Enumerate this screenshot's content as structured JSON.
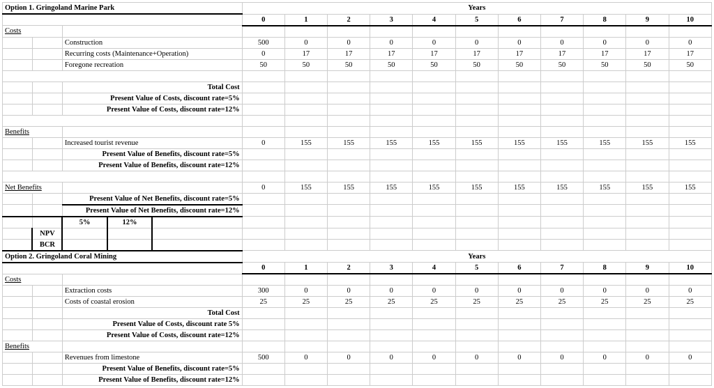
{
  "option1": {
    "title": "Option 1. Gringoland Marine Park",
    "years_label": "Years",
    "costs_label": "Costs",
    "benefits_label": "Benefits",
    "net_benefits_label": "Net Benefits",
    "rows": {
      "construction": {
        "label": "Construction",
        "vals": [
          "500",
          "0",
          "0",
          "0",
          "0",
          "0",
          "0",
          "0",
          "0",
          "0",
          "0"
        ]
      },
      "recurring": {
        "label": "Recurring costs (Maintenance+Operation)",
        "vals": [
          "0",
          "17",
          "17",
          "17",
          "17",
          "17",
          "17",
          "17",
          "17",
          "17",
          "17"
        ]
      },
      "foregone": {
        "label": "Foregone recreation",
        "vals": [
          "50",
          "50",
          "50",
          "50",
          "50",
          "50",
          "50",
          "50",
          "50",
          "50",
          "50"
        ]
      },
      "tourist": {
        "label": "Increased tourist revenue",
        "vals": [
          "0",
          "155",
          "155",
          "155",
          "155",
          "155",
          "155",
          "155",
          "155",
          "155",
          "155"
        ]
      },
      "netbenefits": {
        "vals": [
          "0",
          "155",
          "155",
          "155",
          "155",
          "155",
          "155",
          "155",
          "155",
          "155",
          "155"
        ]
      }
    },
    "total_cost": "Total Cost",
    "pv_costs_5": "Present Value of Costs, discount rate=5%",
    "pv_costs_12": "Present Value of Costs, discount rate=12%",
    "pv_ben_5": "Present Value of Benefits, discount rate=5%",
    "pv_ben_12": "Present Value of Benefits, discount rate=12%",
    "pv_net_5": "Present Value of Net Benefits, discount rate=5%",
    "pv_net_12": "Present Value of Net Benefits, discount rate=12%",
    "rate_5": "5%",
    "rate_12": "12%",
    "npv": "NPV",
    "bcr": "BCR"
  },
  "option2": {
    "title": "Option 2. Gringoland Coral Mining",
    "years_label": "Years",
    "costs_label": "Costs",
    "benefits_label": "Benefits",
    "rows": {
      "extraction": {
        "label": "Extraction costs",
        "vals": [
          "300",
          "0",
          "0",
          "0",
          "0",
          "0",
          "0",
          "0",
          "0",
          "0",
          "0"
        ]
      },
      "erosion": {
        "label": "Costs of coastal erosion",
        "vals": [
          "25",
          "25",
          "25",
          "25",
          "25",
          "25",
          "25",
          "25",
          "25",
          "25",
          "25"
        ]
      },
      "limestone": {
        "label": "Revenues from limestone",
        "vals": [
          "500",
          "0",
          "0",
          "0",
          "0",
          "0",
          "0",
          "0",
          "0",
          "0",
          "0"
        ]
      }
    },
    "total_cost": "Total Cost",
    "pv_costs_5": "Present Value of Costs, discount rate 5%",
    "pv_costs_12": "Present Value of Costs, discount rate=12%",
    "pv_ben_5": "Present Value of Benefits, discount rate=5%",
    "pv_ben_12": "Present Value of Benefits, discount rate=12%"
  },
  "years": [
    "0",
    "1",
    "2",
    "3",
    "4",
    "5",
    "6",
    "7",
    "8",
    "9",
    "10"
  ]
}
